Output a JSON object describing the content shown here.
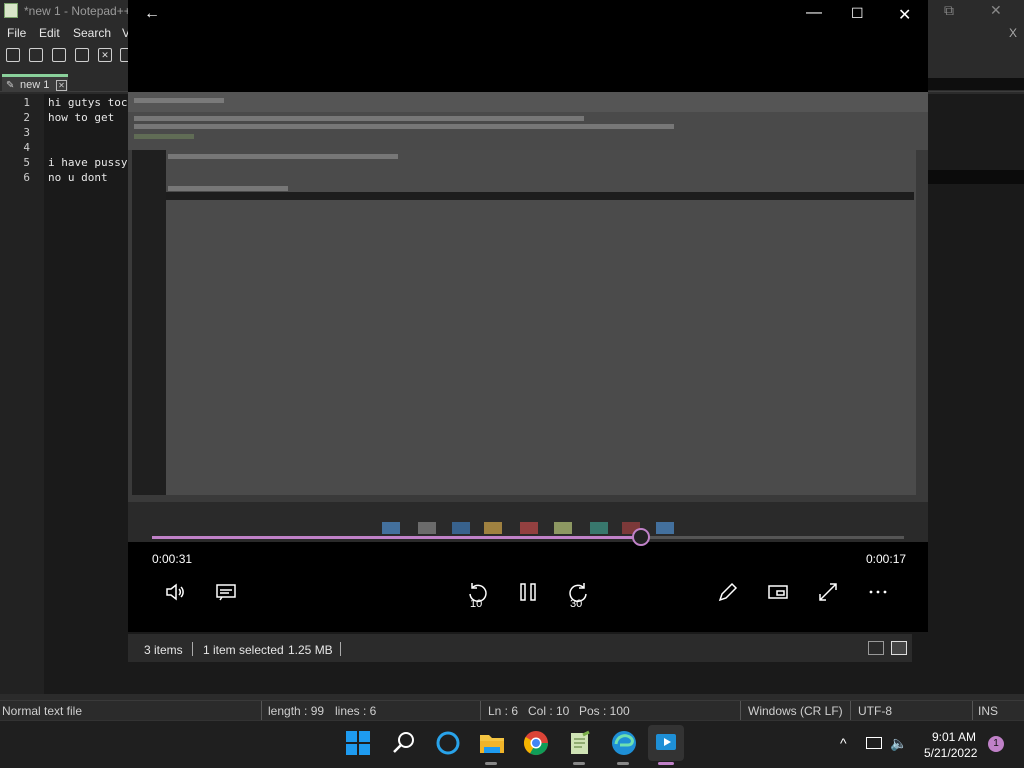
{
  "notepad": {
    "title": "*new 1 - Notepad++",
    "menu": [
      "File",
      "Edit",
      "Search",
      "V"
    ],
    "tab_label": "new 1",
    "lines": [
      "1",
      "2",
      "3",
      "4",
      "5",
      "6"
    ],
    "code": [
      "hi gutys toc",
      "how to get ",
      "",
      "",
      "i have pussy",
      "no u dont"
    ],
    "status": {
      "file_type": "Normal text file",
      "length": "length : 99",
      "lines": "lines : 6",
      "ln": "Ln : 6",
      "col": "Col : 10",
      "pos": "Pos : 100",
      "eol": "Windows (CR LF)",
      "encoding": "UTF-8",
      "mode": "INS"
    },
    "right_controls": [
      "⧉",
      "✕",
      "X"
    ]
  },
  "player": {
    "back_icon": "back-arrow-icon",
    "window_controls": [
      "—",
      "☐",
      "✕"
    ],
    "elapsed": "0:00:31",
    "remaining": "0:00:17",
    "progress_fraction": 0.65,
    "accent": "#c081c8",
    "controls": {
      "volume": "volume-icon",
      "captions": "captions-icon",
      "rewind": "10",
      "play_pause": "pause-icon",
      "forward": "30",
      "edit": "pencil-icon",
      "mini": "miniplayer-icon",
      "fullscreen": "fullscreen-icon",
      "more": "more-icon"
    }
  },
  "explorer_status": {
    "items": "3 items",
    "selected": "1 item selected",
    "size": "1.25 MB"
  },
  "taskbar": {
    "clock_time": "9:01 AM",
    "clock_date": "5/21/2022",
    "notification_count": "1",
    "apps": [
      "start-icon",
      "search-icon",
      "cortana-icon",
      "file-explorer-icon",
      "chrome-icon",
      "notepadpp-icon",
      "edge-icon",
      "media-player-icon"
    ]
  }
}
